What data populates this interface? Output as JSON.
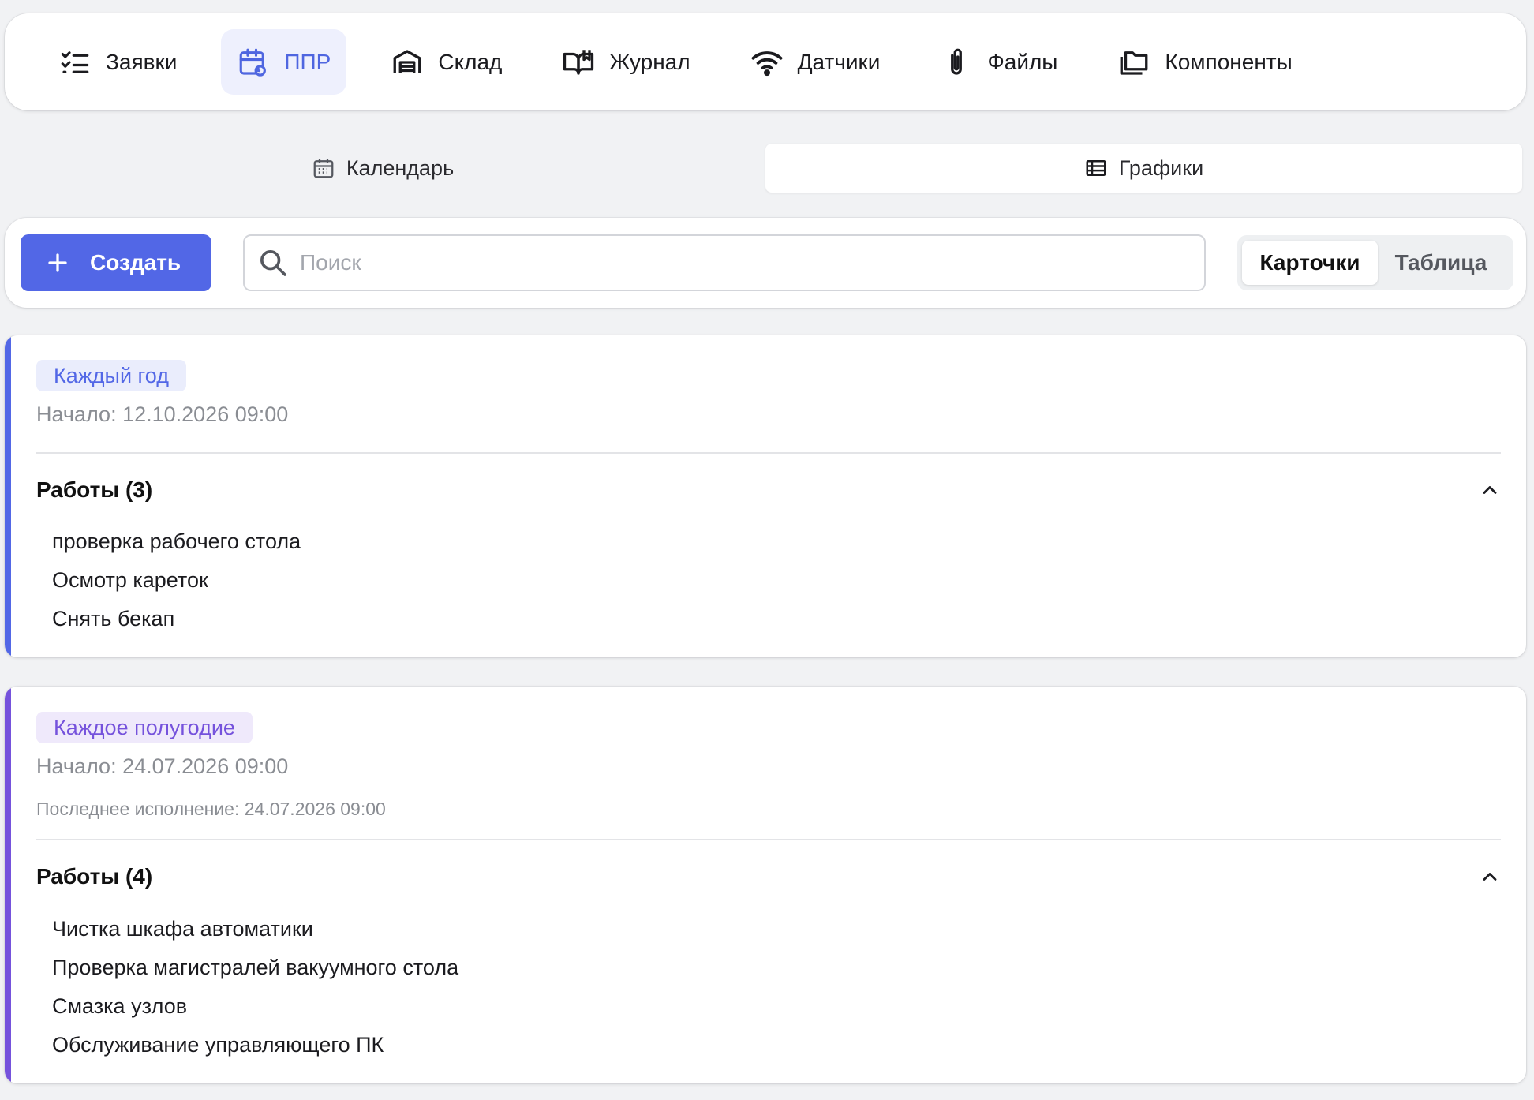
{
  "nav": {
    "items": [
      {
        "label": "Заявки",
        "icon": "checklist-icon",
        "active": false
      },
      {
        "label": "ППР",
        "icon": "calendar-refresh-icon",
        "active": true
      },
      {
        "label": "Склад",
        "icon": "warehouse-icon",
        "active": false
      },
      {
        "label": "Журнал",
        "icon": "book-open-icon",
        "active": false
      },
      {
        "label": "Датчики",
        "icon": "wifi-icon",
        "active": false
      },
      {
        "label": "Файлы",
        "icon": "paperclip-icon",
        "active": false
      },
      {
        "label": "Компоненты",
        "icon": "folders-icon",
        "active": false
      }
    ]
  },
  "subtabs": {
    "calendar": {
      "label": "Календарь",
      "icon": "calendar-icon"
    },
    "schedules": {
      "label": "Графики",
      "icon": "list-icon",
      "active": true
    }
  },
  "toolbar": {
    "create_label": "Создать",
    "search_placeholder": "Поиск",
    "search_value": "",
    "view_cards": "Карточки",
    "view_table": "Таблица",
    "active_view": "Карточки"
  },
  "colors": {
    "accent": "#5267e6",
    "accent_purple": "#7552dc",
    "background": "#f1f2f4"
  },
  "cards": [
    {
      "badge": "Каждый год",
      "start": "Начало: 12.10.2026 09:00",
      "works_title": "Работы (3)",
      "works": [
        "проверка рабочего стола",
        "Осмотр кареток",
        "Снять бекап"
      ]
    },
    {
      "badge": "Каждое полугодие",
      "start": "Начало: 24.07.2026 09:00",
      "last_run": "Последнее исполнение: 24.07.2026 09:00",
      "works_title": "Работы (4)",
      "works": [
        "Чистка шкафа автоматики",
        "Проверка магистралей вакуумного стола",
        "Смазка узлов",
        "Обслуживание управляющего ПК"
      ]
    }
  ]
}
